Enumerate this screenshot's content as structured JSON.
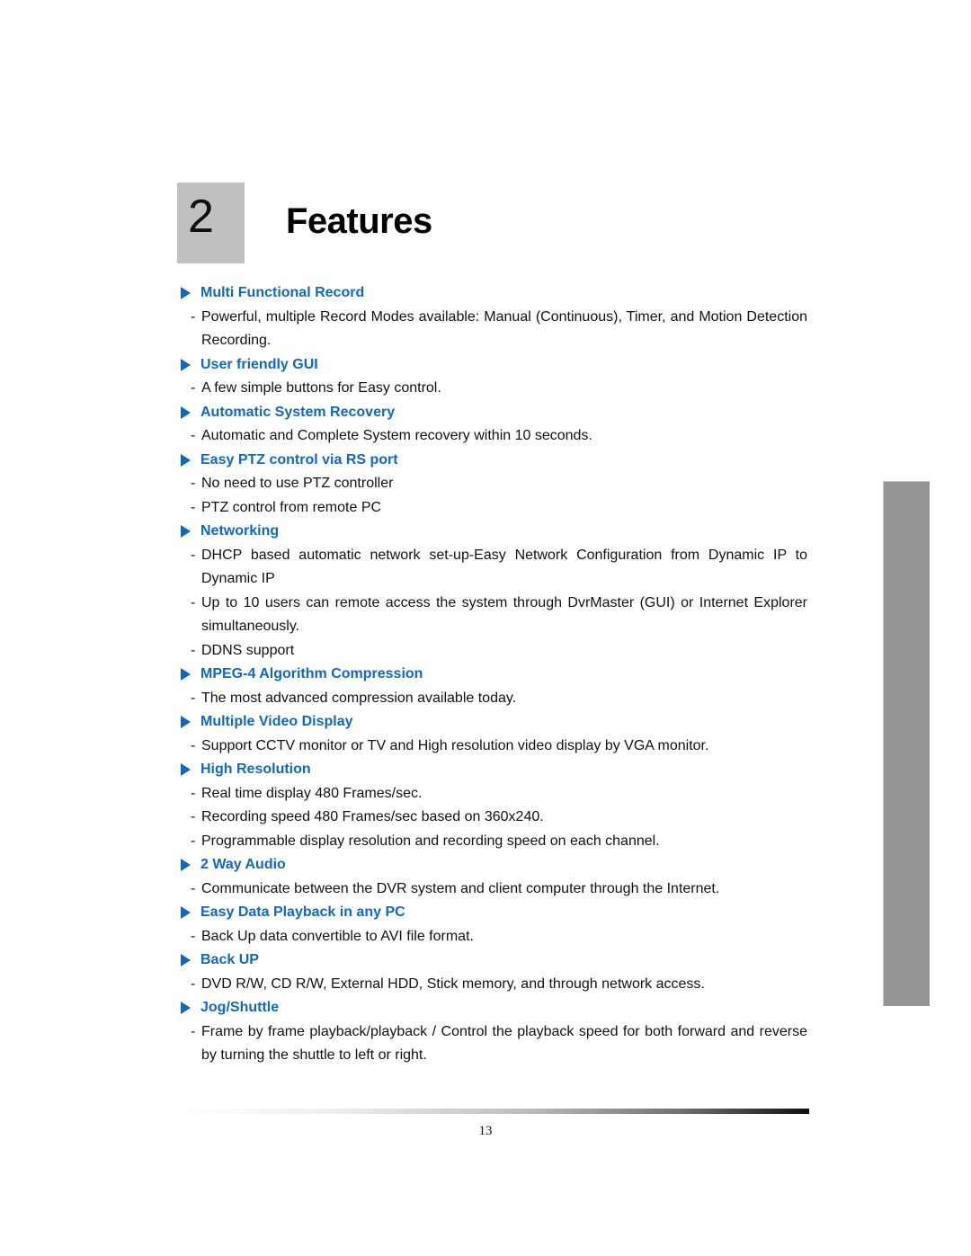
{
  "chapter": {
    "number": "2",
    "title": "Features"
  },
  "colors": {
    "heading": "#1166c6",
    "chapter_box": "#c0c0c0",
    "side_tab": "#959595"
  },
  "sections": [
    {
      "icon": "triangle-bullet-icon",
      "heading": "Multi Functional Record",
      "items": [
        "Powerful, multiple Record Modes available: Manual (Continuous), Timer, and Motion Detection Recording."
      ]
    },
    {
      "icon": "triangle-bullet-icon",
      "heading": "User friendly GUI",
      "items": [
        "A few simple buttons for Easy control."
      ]
    },
    {
      "icon": "triangle-bullet-icon",
      "heading": "Automatic System Recovery",
      "items": [
        "Automatic and Complete System recovery within 10 seconds."
      ]
    },
    {
      "icon": "triangle-bullet-icon",
      "heading": "Easy PTZ control via RS port",
      "items": [
        "No need to use PTZ controller",
        "PTZ control from remote PC"
      ]
    },
    {
      "icon": "triangle-bullet-icon",
      "heading": "Networking",
      "items": [
        "DHCP based automatic network set-up-Easy Network Configuration from Dynamic IP to Dynamic IP",
        "Up to 10 users can remote access the system through DvrMaster (GUI) or Internet Explorer simultaneously.",
        "DDNS support"
      ]
    },
    {
      "icon": "triangle-bullet-icon",
      "heading": "MPEG-4 Algorithm Compression",
      "items": [
        "The most advanced compression available today."
      ]
    },
    {
      "icon": "triangle-bullet-icon",
      "heading": "Multiple Video Display",
      "items": [
        "Support CCTV monitor or TV and High resolution video display by VGA monitor."
      ]
    },
    {
      "icon": "triangle-bullet-icon",
      "heading": "High Resolution",
      "items": [
        "Real time display 480 Frames/sec.",
        "Recording speed 480 Frames/sec based on 360x240.",
        "Programmable display resolution and recording speed on each channel."
      ]
    },
    {
      "icon": "triangle-bullet-icon",
      "heading": "2 Way Audio",
      "items": [
        "Communicate between the DVR system and client computer through the Internet."
      ]
    },
    {
      "icon": "triangle-bullet-icon",
      "heading": "Easy Data Playback in any PC",
      "items": [
        "Back Up data convertible to AVI file format."
      ]
    },
    {
      "icon": "triangle-bullet-icon",
      "heading": "Back UP",
      "items": [
        "DVD R/W, CD R/W, External HDD, Stick memory, and through network access."
      ]
    },
    {
      "icon": "triangle-bullet-icon",
      "heading": "Jog/Shuttle",
      "items": [
        "Frame by frame playback/playback / Control the playback speed for both forward and reverse by turning the shuttle to left or right."
      ]
    }
  ],
  "bullet_dash": "-",
  "footer": {
    "page_number": "13"
  }
}
